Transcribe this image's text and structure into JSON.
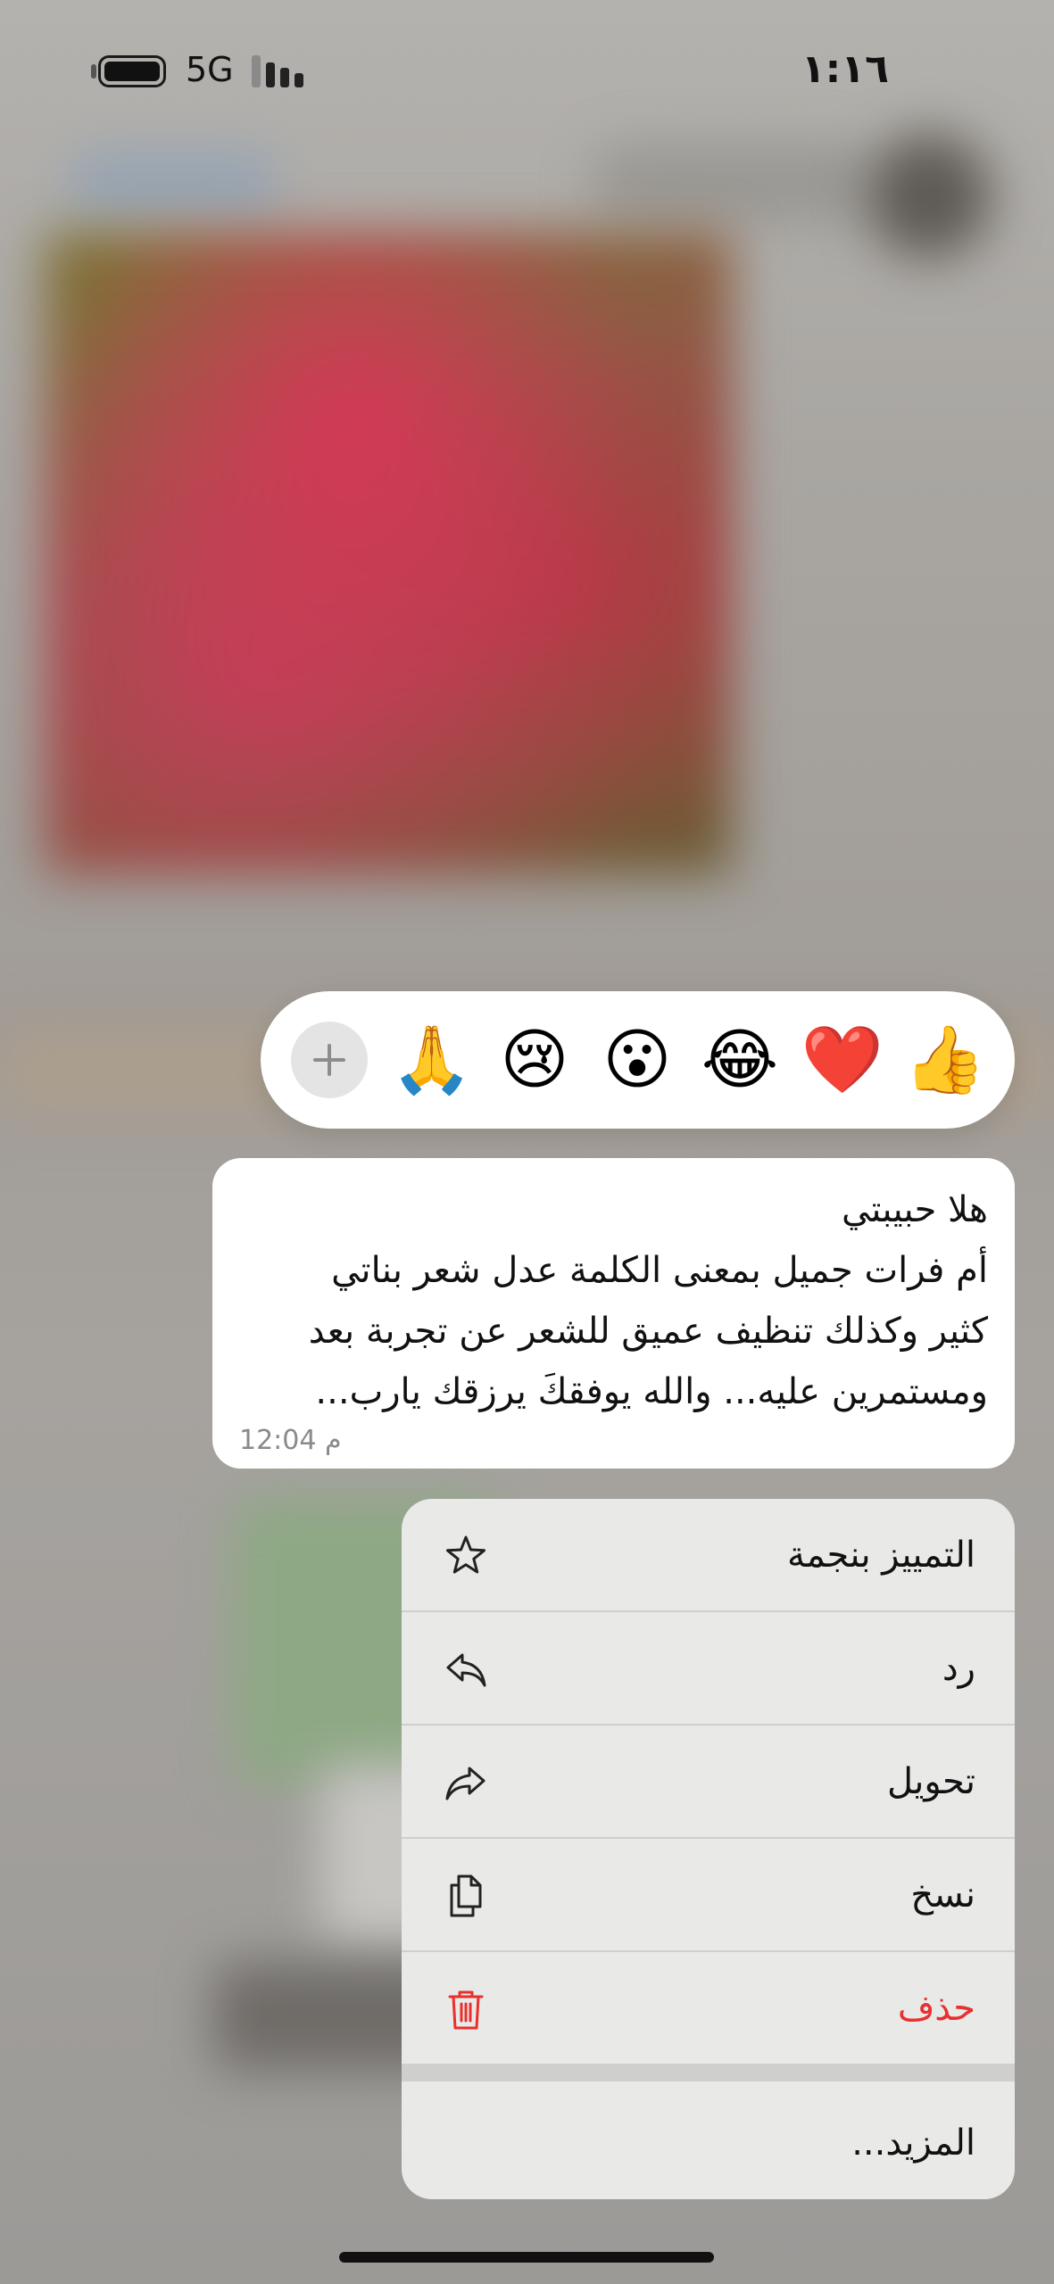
{
  "status_bar": {
    "network": "5G",
    "time": "١:١٦"
  },
  "reactions": {
    "add_icon": "plus-icon",
    "emojis": [
      {
        "name": "thumbs-up",
        "glyph": "👍"
      },
      {
        "name": "heart",
        "glyph": "❤️"
      },
      {
        "name": "laughing",
        "glyph": "😂"
      },
      {
        "name": "surprised",
        "glyph": "😮"
      },
      {
        "name": "crying",
        "glyph": "😢"
      },
      {
        "name": "praying",
        "glyph": "🙏"
      }
    ]
  },
  "message": {
    "line1": "هلا حبيبتي",
    "line2": "أم فرات جميل بمعنى الكلمة عدل شعر بناتي",
    "line3": "كثير وكذلك تنظيف عميق للشعر عن تجربة بعد",
    "line4": "ومستمرين عليه... والله يوفقكَ يرزقك يارب...",
    "time": "12:04 م"
  },
  "menu": {
    "star": {
      "label": "التمييز بنجمة",
      "icon": "star-icon"
    },
    "reply": {
      "label": "رد",
      "icon": "reply-icon"
    },
    "forward": {
      "label": "تحويل",
      "icon": "forward-icon"
    },
    "copy": {
      "label": "نسخ",
      "icon": "copy-icon"
    },
    "delete": {
      "label": "حذف",
      "icon": "trash-icon",
      "color": "#e8302d"
    },
    "more": {
      "label": "المزيد..."
    }
  }
}
